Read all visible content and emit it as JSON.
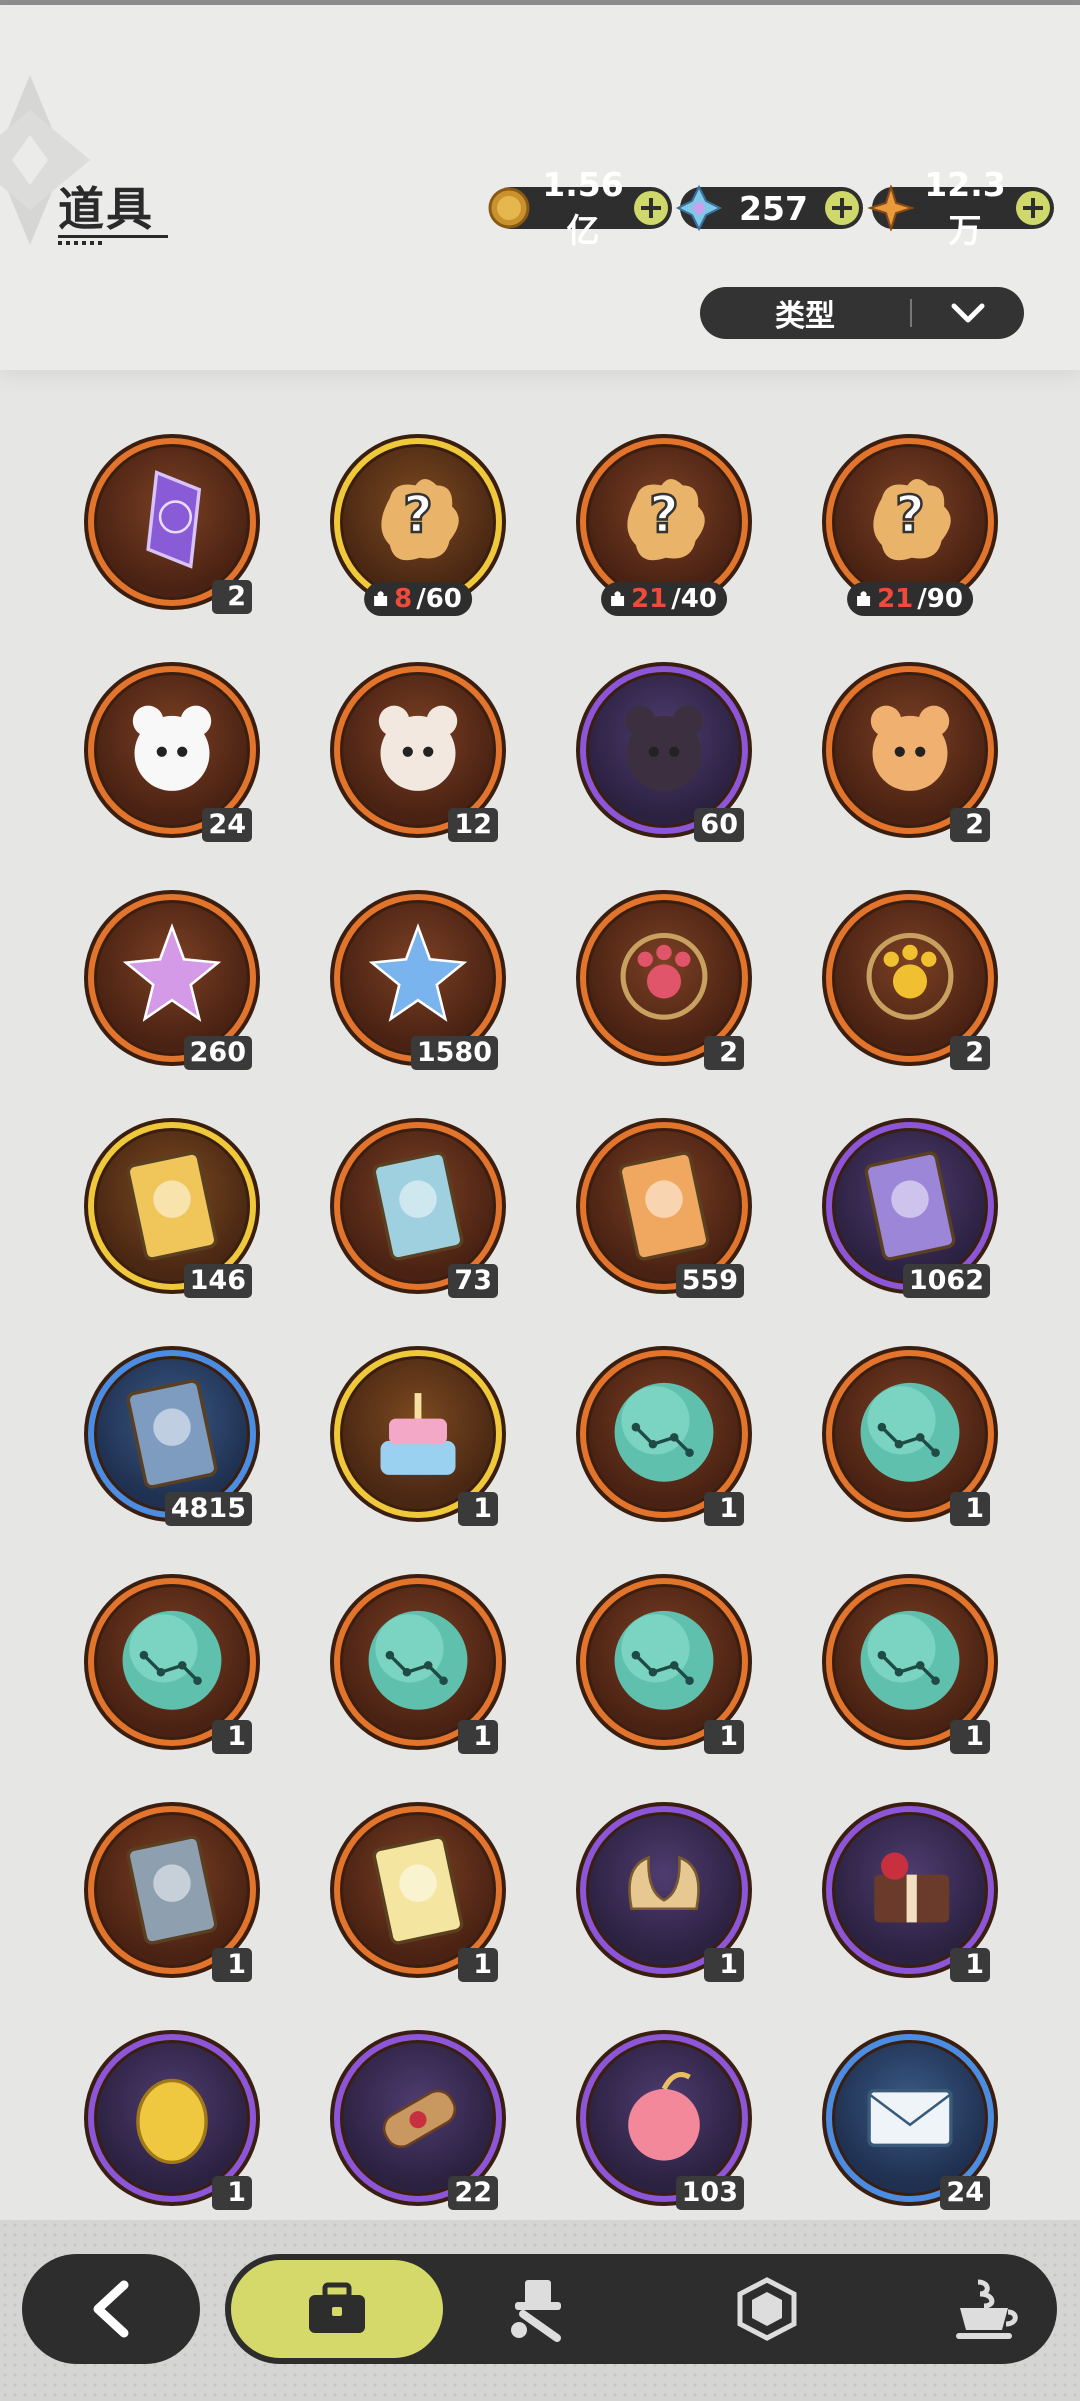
{
  "header": {
    "title": "道具"
  },
  "currencies": [
    {
      "icon": "gold-coin-icon",
      "value": "1.56亿"
    },
    {
      "icon": "crystal-icon",
      "value": "257"
    },
    {
      "icon": "star-gem-icon",
      "value": "12.3万"
    }
  ],
  "filter": {
    "label": "类型"
  },
  "items": [
    {
      "name": "purple-crystal-item",
      "rarity": "orange",
      "count": "2"
    },
    {
      "name": "random-fragment-gold",
      "rarity": "gold",
      "fragment": {
        "current": "8",
        "total": "/60"
      }
    },
    {
      "name": "random-fragment-orange",
      "rarity": "orange",
      "fragment": {
        "current": "21",
        "total": "/40"
      }
    },
    {
      "name": "random-fragment-orange-2",
      "rarity": "orange",
      "fragment": {
        "current": "21",
        "total": "/90"
      }
    },
    {
      "name": "white-cat-fragment",
      "rarity": "orange",
      "count": "24"
    },
    {
      "name": "red-mask-cat-fragment",
      "rarity": "orange",
      "count": "12"
    },
    {
      "name": "black-cat-fragment",
      "rarity": "purple",
      "count": "60"
    },
    {
      "name": "tiger-cat-fragment",
      "rarity": "orange",
      "count": "2"
    },
    {
      "name": "pink-star-crystal",
      "rarity": "orange",
      "count": "260"
    },
    {
      "name": "blue-star-crystal",
      "rarity": "orange",
      "count": "1580"
    },
    {
      "name": "red-paw-compass",
      "rarity": "orange",
      "count": "2"
    },
    {
      "name": "gold-paw-compass",
      "rarity": "orange",
      "count": "2"
    },
    {
      "name": "gold-character-card",
      "rarity": "gold",
      "count": "146"
    },
    {
      "name": "rainbow-character-card",
      "rarity": "orange",
      "count": "73"
    },
    {
      "name": "orange-character-card",
      "rarity": "orange",
      "count": "559"
    },
    {
      "name": "purple-character-card",
      "rarity": "purple",
      "count": "1062"
    },
    {
      "name": "blue-character-card",
      "rarity": "blue",
      "count": "4815"
    },
    {
      "name": "birthday-cake",
      "rarity": "gold",
      "count": "1"
    },
    {
      "name": "constellation-orb-1",
      "rarity": "orange",
      "count": "1"
    },
    {
      "name": "constellation-orb-2",
      "rarity": "orange",
      "count": "1"
    },
    {
      "name": "constellation-orb-3",
      "rarity": "orange",
      "count": "1"
    },
    {
      "name": "constellation-orb-4",
      "rarity": "orange",
      "count": "1"
    },
    {
      "name": "constellation-orb-5",
      "rarity": "orange",
      "count": "1"
    },
    {
      "name": "constellation-orb-6",
      "rarity": "orange",
      "count": "1"
    },
    {
      "name": "reset-card",
      "rarity": "orange",
      "count": "1"
    },
    {
      "name": "clover-card",
      "rarity": "orange",
      "count": "1"
    },
    {
      "name": "gold-horns-item",
      "rarity": "purple",
      "count": "1"
    },
    {
      "name": "gift-box-item",
      "rarity": "purple",
      "count": "1"
    },
    {
      "name": "gold-egg-item",
      "rarity": "purple",
      "count": "1"
    },
    {
      "name": "scroll-item",
      "rarity": "purple",
      "count": "22"
    },
    {
      "name": "pink-apple-item",
      "rarity": "purple",
      "count": "103"
    },
    {
      "name": "letter-item",
      "rarity": "blue",
      "count": "24"
    }
  ],
  "nav": {
    "back": "back-arrow-icon",
    "tabs": [
      "bag-icon",
      "hat-wrench-icon",
      "hexagon-icon",
      "coffee-cup-icon"
    ]
  }
}
